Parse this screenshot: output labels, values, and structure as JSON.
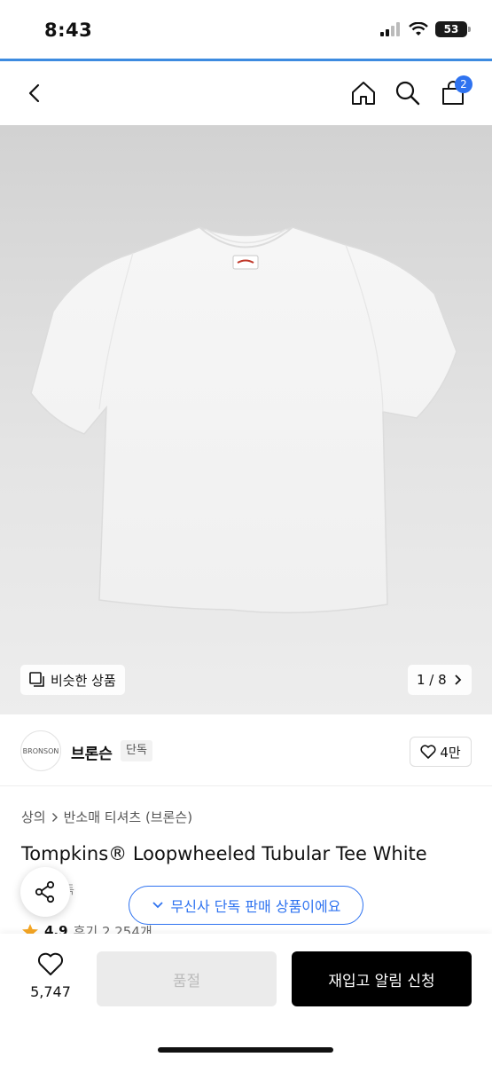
{
  "status_bar": {
    "time": "8:43",
    "battery": "53"
  },
  "header": {
    "cart_count": "2"
  },
  "gallery": {
    "similar_label": "비슷한 상품",
    "counter": "1 / 8"
  },
  "brand": {
    "name": "브론슨",
    "tag": "단독",
    "logo_text": "BRONSON",
    "likes": "4만"
  },
  "breadcrumb": {
    "category": "상의",
    "subcategory": "반소매 티셔츠 (브론슨)"
  },
  "product": {
    "title": "Tompkins® Loopwheeled Tubular Tee White",
    "badge": "단독",
    "exclusive_notice": "무신사 단독 판매 상품이에요",
    "rating": "4.9",
    "reviews": "후기 2,254개"
  },
  "bottom_bar": {
    "wish_count": "5,747",
    "soldout_label": "품절",
    "restock_label": "재입고 알림 신청"
  },
  "colors": {
    "accent": "#2f73f0",
    "primary_button": "#000000",
    "disabled_button": "#ebebeb",
    "star": "#f5a623"
  }
}
